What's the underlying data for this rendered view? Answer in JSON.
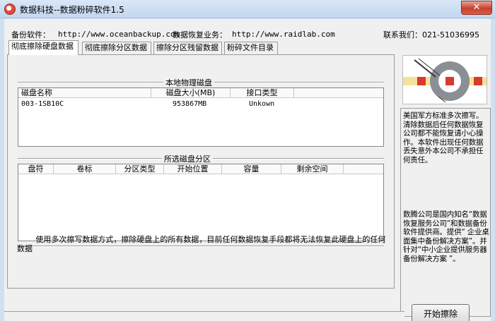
{
  "window": {
    "title": "数据科技--数据粉碎软件1.5",
    "close_glyph": "✕"
  },
  "infobar": {
    "backup_label": "备份软件：",
    "backup_url": "http://www.oceanbackup.com",
    "recovery_label": "数据恢复业务：",
    "recovery_url": "http://www.raidlab.com",
    "contact": "联系我们：021-51036995"
  },
  "tabs": [
    {
      "label": "彻底擦除硬盘数据",
      "active": true
    },
    {
      "label": "彻底擦除分区数据",
      "active": false
    },
    {
      "label": "擦除分区残留数据",
      "active": false
    },
    {
      "label": "粉碎文件目录",
      "active": false
    }
  ],
  "physical_disks": {
    "title": "本地物理磁盘",
    "columns": [
      "磁盘名称",
      "磁盘大小(MB)",
      "接口类型"
    ],
    "rows": [
      {
        "name": "003-1SB10C",
        "size": "953867MB",
        "interface": "Unkown"
      }
    ]
  },
  "partitions": {
    "title": "所选磁盘分区",
    "columns": [
      "盘符",
      "卷标",
      "分区类型",
      "开始位置",
      "容量",
      "剩余空间"
    ],
    "rows": []
  },
  "description": "使用多次擦写数据方式，擦除硬盘上的所有数据，目前任何数据恢复手段都将无法恢复此硬盘上的任何数据",
  "side_panel": {
    "memo_1": "美国军方标准多次擦写。清除数据后任何数据恢复公司都不能恢复请小心操作。本软件出现任何数据丢失意外本公司不承担任何责任。",
    "memo_2": "数腾公司是国内知名“数据恢复服务公司”和数据备份软件提供商。提供“ 企业桌面集中备份解决方案”。并针对“中小企业提供服务器备份解决方案 ”。"
  },
  "buttons": {
    "start": "开始擦除"
  },
  "colors": {
    "title_gradient_top": "#d9e7f7",
    "close_red": "#c7402d",
    "panel_bg": "#f0f0f0"
  }
}
